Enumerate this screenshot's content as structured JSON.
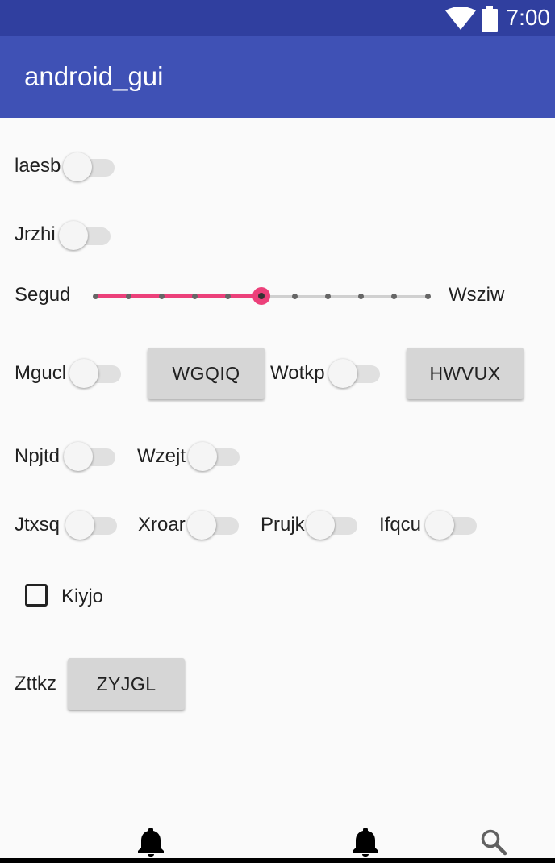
{
  "status_bar": {
    "time": "7:00"
  },
  "app_bar": {
    "title": "android_gui"
  },
  "rows": {
    "laesb": {
      "label": "laesb"
    },
    "jrzhi": {
      "label": "Jrzhi"
    },
    "segud": {
      "label": "Segud",
      "end_label": "Wsziw",
      "value": 5,
      "max": 10
    },
    "mgucl": {
      "label": "Mgucl",
      "button": "WGQIQ"
    },
    "wotkp": {
      "label": "Wotkp",
      "button": "HWVUX"
    },
    "npjtd": {
      "label": "Npjtd"
    },
    "wzejt": {
      "label": "Wzejt"
    },
    "jtxsq": {
      "label": "Jtxsq"
    },
    "xroar": {
      "label": "Xroar"
    },
    "prujk": {
      "label": "Prujk"
    },
    "ifqcu": {
      "label": "Ifqcu"
    },
    "kiyjo": {
      "label": "Kiyjo",
      "checked": false
    },
    "zttkz": {
      "label": "Zttkz",
      "button": "ZYJGL"
    }
  },
  "bottom_nav": {
    "icons": [
      "bell-icon",
      "bell-icon",
      "search-icon"
    ]
  },
  "colors": {
    "status_bar": "#303f9f",
    "app_bar": "#3f51b5",
    "accent": "#ec407a",
    "button": "#d6d6d6"
  }
}
